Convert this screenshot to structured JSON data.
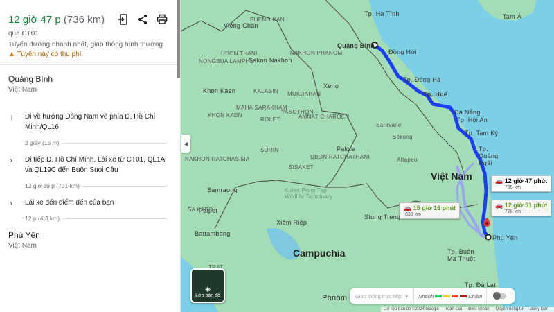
{
  "summary": {
    "duration": "12 giờ 47 p",
    "distance": "(736 km)",
    "via": "qua CT01",
    "note": "Tuyến đường nhanh nhất, giao thông bình thường",
    "toll_warning": "Tuyến này có thu phí.",
    "actions": [
      "send-to-phone-icon",
      "share-icon",
      "print-icon"
    ]
  },
  "origin": {
    "name": "Quảng Bình",
    "country": "Việt Nam"
  },
  "steps": [
    {
      "icon": "arrow-up-icon",
      "text": "Đi về hướng Đông Nam về phía Đ. Hồ Chí Minh/QL16",
      "duration": "2 giây (15 m)"
    },
    {
      "icon": "chevron-right-icon",
      "text": "Đi tiếp Đ. Hồ Chí Minh. Lái xe từ CT01, QL1A và QL19C đến Buôn Suoi Câu",
      "duration": "12 giờ 39 p (731 km)"
    },
    {
      "icon": "chevron-right-icon",
      "text": "Lái xe đến điểm đến của bạn",
      "duration": "12 p (4,3 km)"
    }
  ],
  "destination": {
    "name": "Phú Yên",
    "country": "Việt Nam"
  },
  "map": {
    "labels": [
      "Viêng Chăn",
      "BUENG KAN",
      "UDON THANI",
      "NONGBUA LAMPHU",
      "Sakon Nakhon",
      "NAKHON PHANOM",
      "Xeno",
      "KALASIN",
      "MUKDAHAN",
      "Khon Kaen",
      "KHON KAEN",
      "MAHA SARAKHAM",
      "ROI ET",
      "YASOTHON",
      "AMNAT CHAROEN",
      "SURIN",
      "UBON RATCHATHANI",
      "NAKHON RATCHASIMA",
      "SISAKET",
      "Pakxe",
      "Saravane",
      "Sekong",
      "Attapeu",
      "Kulen Prum Tep Wildlife Sanctuary",
      "Samraong",
      "Poipet",
      "SA KAEO",
      "Xiêm Riệp",
      "Battambang",
      "TRAT",
      "Stung Treng",
      "Campuchia",
      "Phnôm Pênh",
      "Việt Nam",
      "Quảng Bình",
      "Đồng Hới",
      "Tp. Đông Hà",
      "Tp. Huế",
      "Đà Nẵng",
      "Tp. Hội An",
      "Tp. Tam Kỳ",
      "Tp. Quảng Ngãi",
      "Tp. Hà Tĩnh",
      "Tam Á",
      "Phú Yên",
      "Tp. Buôn Ma Thuột",
      "Tp. Đà Lạt"
    ],
    "routes": [
      {
        "duration": "12 giờ 47 phút",
        "distance": "736 km",
        "selected": true
      },
      {
        "duration": "12 giờ 51 phút",
        "distance": "728 km",
        "selected": false
      },
      {
        "duration": "15 giờ 16 phút",
        "distance": "839 km",
        "selected": false
      }
    ],
    "route_color": "#1a3dff",
    "alt_route_color": "#9aa6f0",
    "layers_label": "Lớp bản đồ",
    "traffic": {
      "select": "Giao thông trực tiếp",
      "fast": "Nhanh",
      "slow": "Chậm",
      "colors": [
        "#1ed760",
        "#ffcd2e",
        "#f2453d",
        "#a8191c"
      ]
    },
    "footer": [
      "Dữ liệu bản đồ ©2024 Google",
      "Toàn cầu",
      "Điều khoản",
      "Quyền riêng tư",
      "Gửi ý kiến"
    ]
  }
}
